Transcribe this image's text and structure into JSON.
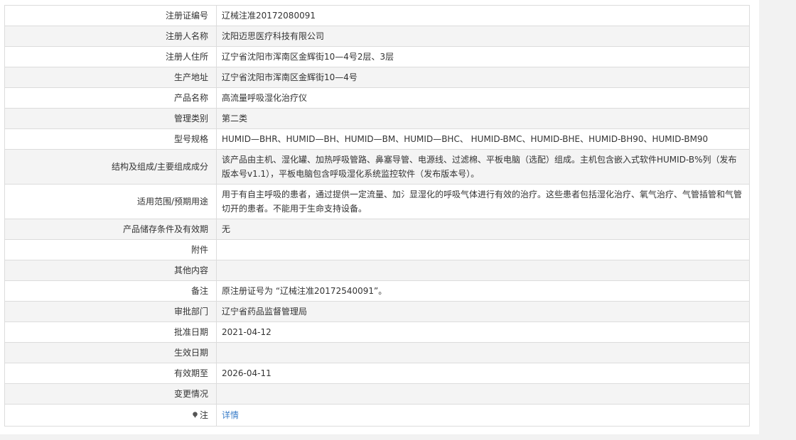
{
  "rows": [
    {
      "label": "注册证编号",
      "value": "辽械注准20172080091"
    },
    {
      "label": "注册人名称",
      "value": "沈阳迈思医疗科技有限公司"
    },
    {
      "label": "注册人住所",
      "value": "辽宁省沈阳市浑南区金辉街10—4号2层、3层"
    },
    {
      "label": "生产地址",
      "value": "辽宁省沈阳市浑南区金辉街10—4号"
    },
    {
      "label": "产品名称",
      "value": "高流量呼吸湿化治疗仪"
    },
    {
      "label": "管理类别",
      "value": "第二类"
    },
    {
      "label": "型号规格",
      "value": "HUMID—BHR、HUMID—BH、HUMID—BM、HUMID—BHC、 HUMID-BMC、HUMID-BHE、HUMID-BH90、HUMID-BM90"
    },
    {
      "label": "结构及组成/主要组成成分",
      "value": "该产品由主机、湿化罐、加热呼吸管路、鼻塞导管、电源线、过滤棉、平板电脑（选配）组成。主机包含嵌入式软件HUMID-B%列（发布版本号v1.1），平板电脑包含呼吸湿化系统监控软件（发布版本号）。"
    },
    {
      "label": "适用范围/预期用途",
      "value": "用于有自主呼吸的患者，通过提供一定流量、加氵显湿化的呼吸气体进行有效的治疗。这些患者包括湿化治疗、氧气治疗、气管插管和气管切开的患者。不能用于生命支持设备。"
    },
    {
      "label": "产品储存条件及有效期",
      "value": "无"
    },
    {
      "label": "附件",
      "value": ""
    },
    {
      "label": "其他内容",
      "value": ""
    },
    {
      "label": "备注",
      "value": "原注册证号为 “辽械注准20172540091”。"
    },
    {
      "label": "审批部门",
      "value": "辽宁省药品监督管理局"
    },
    {
      "label": "批准日期",
      "value": "2021-04-12"
    },
    {
      "label": "生效日期",
      "value": ""
    },
    {
      "label": "有效期至",
      "value": "2026-04-11"
    },
    {
      "label": "变更情况",
      "value": ""
    }
  ],
  "note": {
    "label": "注",
    "icon": "pin-icon",
    "link_text": "详情"
  },
  "colors": {
    "link": "#3a7dc9",
    "shade": "#f4f4f4",
    "border": "#dcdcdc"
  }
}
